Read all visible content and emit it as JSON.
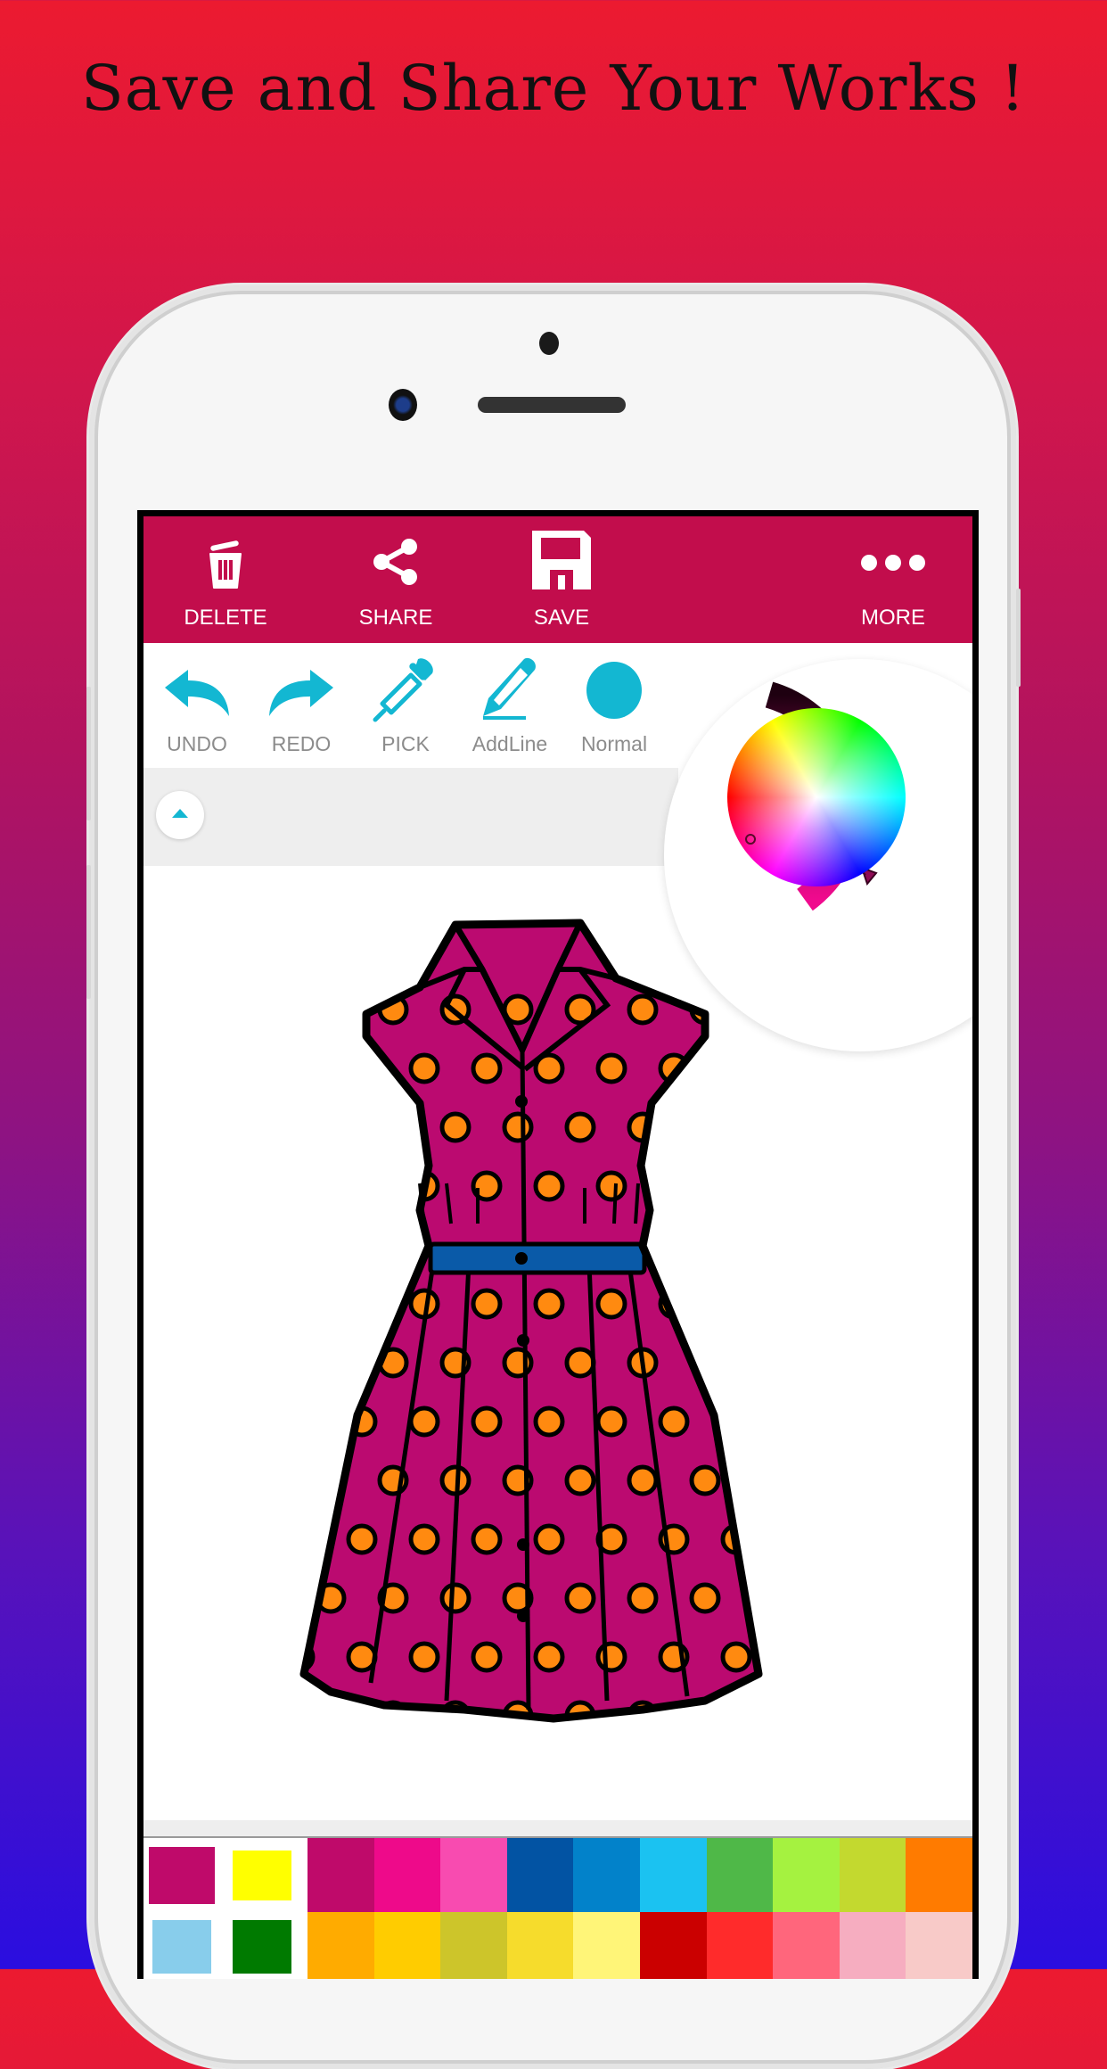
{
  "headline": "Save and Share Your Works !",
  "topbar": {
    "bg_color": "#c20d4c",
    "buttons": [
      {
        "id": "delete",
        "label": "DELETE",
        "icon": "trash-icon"
      },
      {
        "id": "share",
        "label": "SHARE",
        "icon": "share-icon"
      },
      {
        "id": "save",
        "label": "SAVE",
        "icon": "floppy-disk-icon"
      },
      {
        "id": "more",
        "label": "MORE",
        "icon": "more-dots-icon"
      }
    ]
  },
  "tools": {
    "accent_color": "#13b7d2",
    "items": [
      {
        "id": "undo",
        "label": "UNDO",
        "icon": "undo-arrow-icon"
      },
      {
        "id": "redo",
        "label": "REDO",
        "icon": "redo-arrow-icon"
      },
      {
        "id": "pick",
        "label": "PICK",
        "icon": "eyedropper-icon"
      },
      {
        "id": "addline",
        "label": "AddLine",
        "icon": "pencil-icon"
      },
      {
        "id": "normal",
        "label": "Normal",
        "icon": "brush-circle-icon"
      }
    ]
  },
  "color_picker": {
    "selected_color": "#c20d6e",
    "brightness_gradient": [
      "#f00a8e",
      "#8e0a55",
      "#1e0010"
    ]
  },
  "canvas": {
    "artwork": "polka-dot-dress",
    "dress_color": "#bb0a70",
    "dot_color": "#ff8a10",
    "belt_color": "#0a5aa8"
  },
  "palette": {
    "recent": [
      "#bf0a6a",
      "#ffff00",
      "#88cdeb",
      "#007a00"
    ],
    "row1": [
      "#bf0a6a",
      "#ee0a8a",
      "#f84bb0",
      "#0253a3",
      "#0282ca",
      "#1bc2f1",
      "#4fb848",
      "#a5f240",
      "#c3d92f",
      "#ff7b00"
    ],
    "row2": [
      "#ffab00",
      "#ffcc00",
      "#cdc52a",
      "#f6dc2c",
      "#fff578",
      "#cb0000",
      "#ff2b2b",
      "#ff667c",
      "#f6adc0",
      "#f8cac8"
    ]
  }
}
